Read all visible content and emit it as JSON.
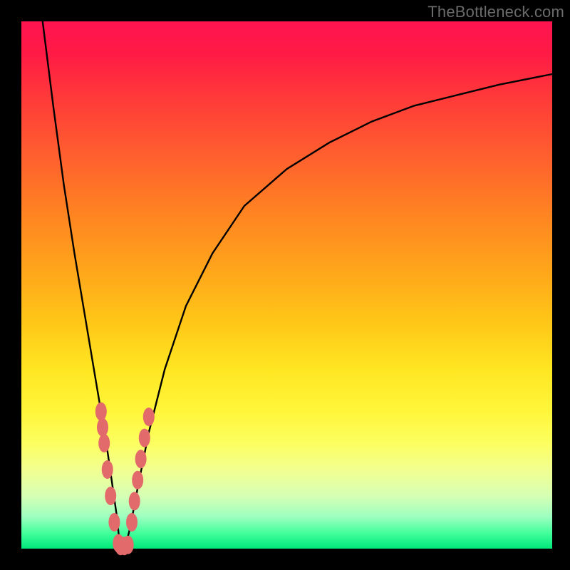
{
  "watermark": "TheBottleneck.com",
  "chart_data": {
    "type": "line",
    "title": "",
    "xlabel": "",
    "ylabel": "",
    "xlim": [
      0,
      100
    ],
    "ylim": [
      0,
      100
    ],
    "grid": false,
    "legend": false,
    "series": [
      {
        "name": "curve",
        "x": [
          4,
          6,
          8,
          10,
          12,
          14,
          15,
          16,
          17,
          18,
          18.6,
          19.5,
          20.5,
          22,
          24,
          27,
          31,
          36,
          42,
          50,
          58,
          66,
          74,
          82,
          90,
          100
        ],
        "y": [
          100,
          84,
          69,
          56,
          44,
          32,
          26,
          20,
          13,
          6,
          0,
          0,
          4,
          12,
          22,
          34,
          46,
          56,
          65,
          72,
          77,
          81,
          84,
          86,
          88,
          90
        ]
      }
    ],
    "markers": [
      {
        "name": "beads-left",
        "points_xy": [
          [
            15.0,
            26
          ],
          [
            15.3,
            23
          ],
          [
            15.6,
            20
          ],
          [
            16.2,
            15
          ],
          [
            16.8,
            10
          ],
          [
            17.5,
            5
          ],
          [
            18.3,
            1
          ]
        ]
      },
      {
        "name": "beads-bottom",
        "points_xy": [
          [
            18.7,
            0.5
          ],
          [
            19.4,
            0.5
          ],
          [
            20.1,
            0.7
          ]
        ]
      },
      {
        "name": "beads-right",
        "points_xy": [
          [
            20.8,
            5
          ],
          [
            21.3,
            9
          ],
          [
            21.9,
            13
          ],
          [
            22.5,
            17
          ],
          [
            23.2,
            21
          ],
          [
            24.0,
            25
          ]
        ]
      }
    ],
    "marker_color": "#e36a6a",
    "curve_color": "#000000"
  }
}
